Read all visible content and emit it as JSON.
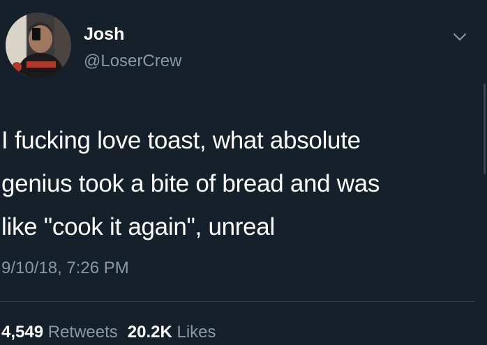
{
  "user": {
    "display_name": "Josh",
    "handle": "@LoserCrew"
  },
  "tweet": {
    "lines": [
      "I fucking love toast, what absolute",
      "genius took a bite of bread and was",
      "like \"cook it again\", unreal"
    ],
    "timestamp": "9/10/18, 7:26 PM"
  },
  "stats": {
    "retweets_count": "4,549",
    "retweets_label": "Retweets",
    "likes_count": "20.2K",
    "likes_label": "Likes"
  },
  "icons": {
    "menu": "chevron-down-icon"
  },
  "colors": {
    "background": "#15202b",
    "secondary_text": "#8899a6",
    "primary_text": "#ffffff"
  }
}
